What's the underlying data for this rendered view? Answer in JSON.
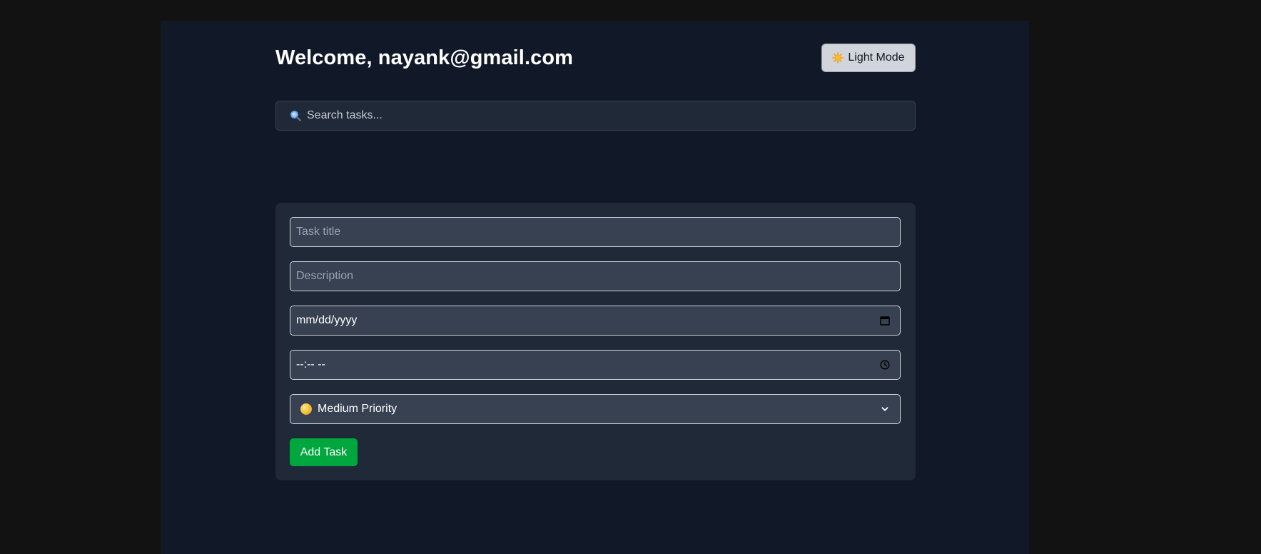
{
  "header": {
    "welcome_text": "Welcome, nayank@gmail.com",
    "theme_toggle_label": "Light Mode",
    "theme_toggle_icon": "sun-icon"
  },
  "search": {
    "icon": "search-icon",
    "placeholder": "Search tasks..."
  },
  "task_form": {
    "title_placeholder": "Task title",
    "description_placeholder": "Description",
    "date_value": "mm/dd/yyyy",
    "date_icon": "calendar-icon",
    "time_value": "--:-- --",
    "time_icon": "clock-icon",
    "priority_selected": "Medium Priority",
    "priority_icon": "yellow-circle-icon",
    "add_button_label": "Add Task"
  },
  "colors": {
    "outer_background": "#121212",
    "page_background": "#111827",
    "card_background": "#1f2937",
    "field_background": "#374151",
    "add_button": "#00a63e",
    "theme_button": "#d1d5db"
  }
}
